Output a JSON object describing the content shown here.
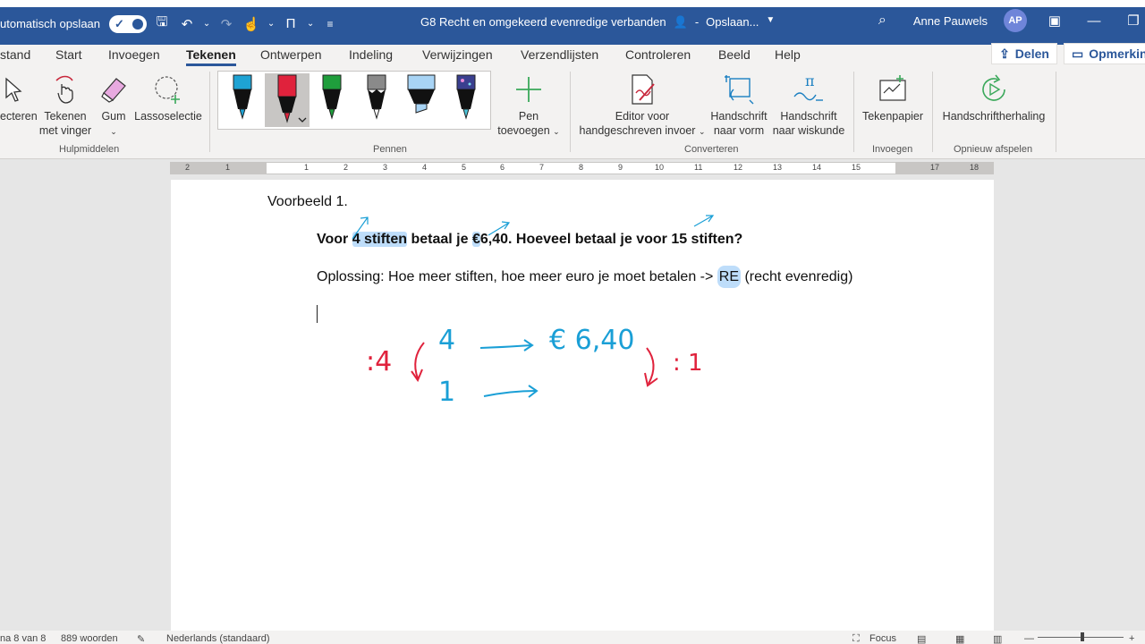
{
  "titlebar": {
    "autosave_label": "utomatisch opslaan",
    "doc_title": "G8 Recht en omgekeerd evenredige verbanden",
    "save_status": "Opslaan...",
    "user_name": "Anne Pauwels",
    "user_initials": "AP"
  },
  "tabs": [
    "stand",
    "Start",
    "Invoegen",
    "Tekenen",
    "Ontwerpen",
    "Indeling",
    "Verwijzingen",
    "Verzendlijsten",
    "Controleren",
    "Beeld",
    "Help"
  ],
  "share_label": "Delen",
  "comments_label": "Opmerking",
  "ribbon": {
    "tools": {
      "select": "ecteren",
      "draw_finger_1": "Tekenen",
      "draw_finger_2": "met vinger",
      "eraser": "Gum",
      "lasso": "Lassoselectie",
      "group": "Hulpmiddelen"
    },
    "pens": {
      "group": "Pennen",
      "add_1": "Pen",
      "add_2": "toevoegen"
    },
    "convert": {
      "editor_1": "Editor voor",
      "editor_2": "handgeschreven invoer",
      "shape_1": "Handschrift",
      "shape_2": "naar vorm",
      "math_1": "Handschrift",
      "math_2": "naar wiskunde",
      "group": "Converteren"
    },
    "insert": {
      "paper": "Tekenpapier",
      "group": "Invoegen"
    },
    "replay": {
      "label": "Handschriftherhaling",
      "group": "Opnieuw afspelen"
    }
  },
  "ruler_ticks": [
    "2",
    "1",
    "1",
    "2",
    "3",
    "4",
    "5",
    "6",
    "7",
    "8",
    "9",
    "10",
    "11",
    "12",
    "13",
    "14",
    "15",
    "17",
    "18"
  ],
  "document": {
    "heading": "Voorbeeld 1.",
    "question_a": "Voor ",
    "question_b": "4 stiften",
    "question_c": " betaal je ",
    "question_d": "€",
    "question_e": "6,40. Hoeveel betaal je voor 15 stiften?",
    "solution_a": "Oplossing: Hoe meer stiften, hoe meer euro je moet betalen -> ",
    "solution_b": "RE",
    "solution_c": " (recht evenredig)",
    "ink": {
      "left_divisor": ":4",
      "top_left": "4",
      "top_right": "€ 6,40",
      "bottom_left": "1",
      "right_divisor": ": 1"
    }
  },
  "statusbar": {
    "page": "na 8 van 8",
    "words": "889 woorden",
    "language": "Nederlands (standaard)",
    "focus": "Focus"
  },
  "colors": {
    "brand": "#2b579a",
    "ink_blue": "#1a9fd6",
    "ink_red": "#e0223c",
    "highlight": "#6eb4f5"
  }
}
